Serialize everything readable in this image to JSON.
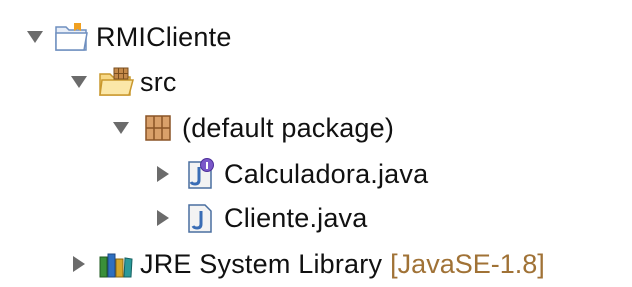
{
  "tree": {
    "project": {
      "label": "RMICliente",
      "expanded": true,
      "icon": "project-folder-icon"
    },
    "src": {
      "label": "src",
      "expanded": true,
      "icon": "source-folder-icon"
    },
    "package": {
      "label": "(default package)",
      "expanded": true,
      "icon": "package-icon"
    },
    "files": [
      {
        "label": "Calculadora.java",
        "expanded": false,
        "icon": "java-interface-file-icon"
      },
      {
        "label": "Cliente.java",
        "expanded": false,
        "icon": "java-file-icon"
      }
    ],
    "library": {
      "label": "JRE System Library",
      "decoration": "[JavaSE-1.8]",
      "expanded": false,
      "icon": "library-books-icon"
    }
  },
  "colors": {
    "text": "#111111",
    "decoration": "#a07236",
    "toggle": "#6b6b6b"
  }
}
